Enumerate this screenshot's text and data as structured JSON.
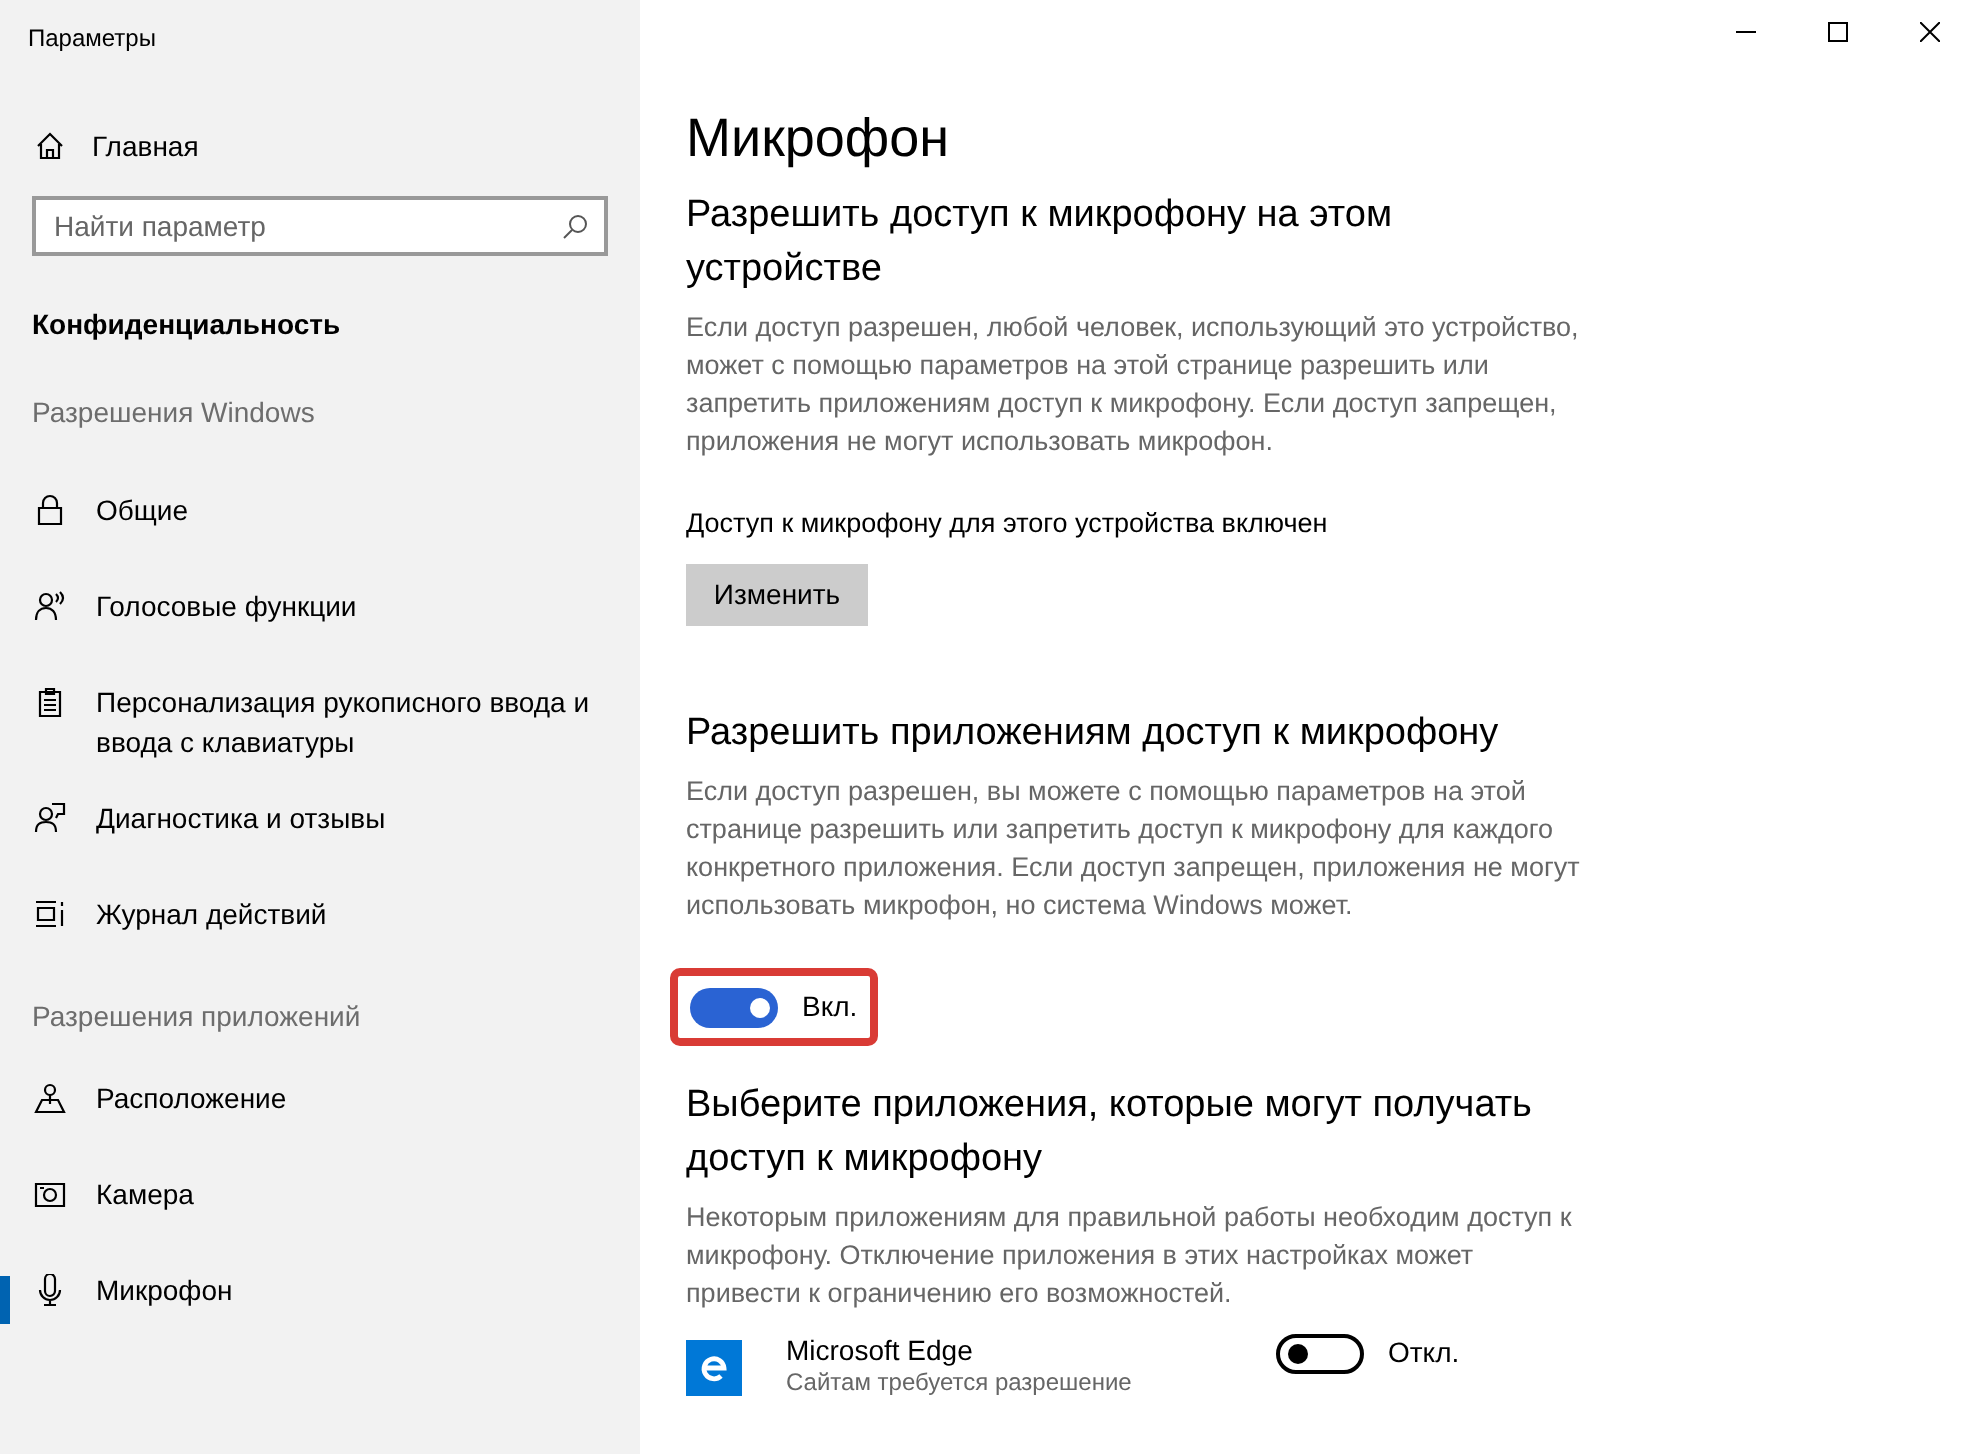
{
  "window": {
    "title": "Параметры"
  },
  "sidebar": {
    "home": "Главная",
    "search": {
      "placeholder": "Найти параметр"
    },
    "category": "Конфиденциальность",
    "groups": [
      {
        "heading": "Разрешения Windows",
        "items": [
          {
            "label": "Общие",
            "kind": "lock",
            "selected": false
          },
          {
            "label": "Голосовые функции",
            "kind": "voice",
            "selected": false
          },
          {
            "label": "Персонализация рукописного ввода и ввода с клавиатуры",
            "kind": "clipboard",
            "selected": false
          },
          {
            "label": "Диагностика и отзывы",
            "kind": "feedback",
            "selected": false
          },
          {
            "label": "Журнал действий",
            "kind": "timeline",
            "selected": false
          }
        ]
      },
      {
        "heading": "Разрешения приложений",
        "items": [
          {
            "label": "Расположение",
            "kind": "location",
            "selected": false
          },
          {
            "label": "Камера",
            "kind": "camera",
            "selected": false
          },
          {
            "label": "Микрофон",
            "kind": "mic",
            "selected": true
          }
        ]
      }
    ]
  },
  "page": {
    "title": "Микрофон",
    "device_section": {
      "heading": "Разрешить доступ к микрофону на этом устройстве",
      "text": "Если доступ разрешен, любой человек, использующий это устройство, может с помощью параметров на этой странице разрешить или запретить приложениям доступ к микрофону. Если доступ запрещен, приложения не могут использовать микрофон.",
      "status": "Доступ к микрофону для этого устройства включен",
      "button": "Изменить"
    },
    "apps_section": {
      "heading": "Разрешить приложениям доступ к микрофону",
      "text": "Если доступ разрешен, вы можете с помощью параметров на этой странице разрешить или запретить доступ к микрофону для каждого конкретного приложения. Если доступ запрещен, приложения не могут использовать микрофон, но система Windows может.",
      "toggle": {
        "on": true,
        "label": "Вкл.",
        "highlighted": true
      }
    },
    "choose_section": {
      "heading": "Выберите приложения, которые могут получать доступ к микрофону",
      "text": "Некоторым приложениям для правильной работы необходим доступ к микрофону. Отключение приложения в этих настройках может привести к ограничению его возможностей.",
      "apps": [
        {
          "name": "Microsoft Edge",
          "description": "Сайтам требуется разрешение",
          "on": false,
          "label": "Откл."
        }
      ]
    }
  }
}
